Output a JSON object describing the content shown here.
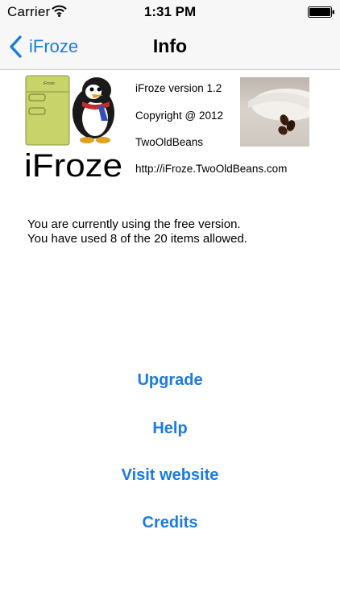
{
  "status_bar": {
    "carrier": "Carrier",
    "time": "1:31 PM",
    "wifi_icon": "wifi-icon",
    "battery_icon": "battery-icon"
  },
  "nav": {
    "back_label": "iFroze",
    "title": "Info",
    "back_icon": "chevron-left-icon",
    "accent_color": "#1b7be0"
  },
  "app_info": {
    "logo_text": "iFroze",
    "logo_fridge_label": "iFroze",
    "version": "iFroze version 1.2",
    "copyright": "Copyright @ 2012",
    "company": "TwoOldBeans",
    "website": "http://iFroze.TwoOldBeans.com"
  },
  "notice": {
    "line1": "You are currently using the free version.",
    "line2": "You have used 8 of the 20 items allowed."
  },
  "actions": {
    "upgrade": "Upgrade",
    "help": "Help",
    "visit_website": "Visit website",
    "credits": "Credits"
  }
}
